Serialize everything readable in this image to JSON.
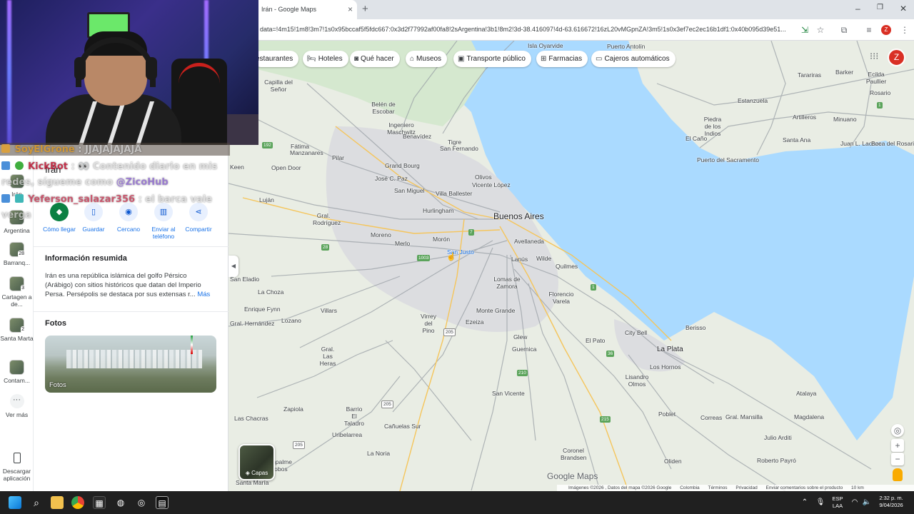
{
  "browser": {
    "tab_title": "Irán - Google Maps",
    "tab_close": "×",
    "new_tab": "+",
    "url": "data=!4m15!1m8!3m7!1s0x95bccaf5f5fdc667:0x3d2f77992af00fa8!2sArgentina!3b1!8m2!3d-38.416097!4d-63.616672!16zL20vMGpnZA!3m5!1s0x3ef7ec2ec16b1df1:0x40b095d39e51...",
    "minimize": "–",
    "restore": "❐",
    "close": "✕",
    "profile": "Z"
  },
  "chat": {
    "line1_user": "SoyElGrone",
    "line1_text": ": JJAJAJAJAJA",
    "line2_user": "KickBot",
    "line2_text": ": 👀 Contenido diario en mis",
    "line3_text": "redes, sígueme como",
    "line3_mention": "@ZicoHub",
    "line4_user": "Yeferson_salazar356",
    "line4_text": ": el barca vale",
    "line5_text": "verga"
  },
  "rail": {
    "item1_label": "Irán",
    "item2_label": "Argentina",
    "item3_label": "Barranq...",
    "item3_count": "28",
    "item4_label": "Cartagen a de...",
    "item4_count": "3",
    "item5_label": "Santa Marta",
    "item5_count": "2",
    "item6_label": "Contam...",
    "more_label": "Ver más",
    "download_label": "Descargar aplicación"
  },
  "panel": {
    "title": "Irán",
    "actions": {
      "directions": "Cómo llegar",
      "save": "Guardar",
      "nearby": "Cercano",
      "send": "Enviar al teléfono",
      "share": "Compartir"
    },
    "summary_title": "Información resumida",
    "summary_text": "Irán es una república islámica del golfo Pérsico (Arábigo) con sitios históricos que datan del Imperio Persa. Persépolis se destaca por sus extensas r...",
    "summary_more": "Más",
    "photos_title": "Fotos",
    "photos_label": "Fotos"
  },
  "chips": {
    "restaurants": "estaurantes",
    "hotels": "Hoteles",
    "things": "Qué hacer",
    "museums": "Museos",
    "transit": "Transporte público",
    "pharmacies": "Farmacias",
    "atms": "Cajeros automáticos"
  },
  "map": {
    "labels": {
      "buenos_aires": "Buenos Aires",
      "la_plata": "La Plata",
      "capilla": "Capilla del Señor",
      "belen": "Belén de Escobar",
      "ingeniero": "Ingeniero Maschwitz",
      "benavidez": "Benavídez",
      "tigre": "Tigre",
      "san_fernando": "San Fernando",
      "pilar": "Pilar",
      "grand_bourg": "Grand Bourg",
      "jose_c_paz": "José C. Paz",
      "san_miguel": "San Miguel",
      "olivos": "Olivos",
      "vicente_lopez": "Vicente López",
      "villa_ballester": "Villa Ballester",
      "hurlingham": "Hurlingham",
      "moreno": "Moreno",
      "merlo": "Merlo",
      "moron": "Morón",
      "san_justo": "San Justo",
      "avellaneda": "Avellaneda",
      "lanus": "Lanús",
      "wilde": "Wilde",
      "quilmes": "Quilmes",
      "lomas": "Lomas de Zamora",
      "florencio": "Florencio Varela",
      "monte_grande": "Monte Grande",
      "ezeiza": "Ezeiza",
      "virrey": "Virrey del Pino",
      "glew": "Glew",
      "guernica": "Guernica",
      "el_pato": "El Pato",
      "city_bell": "City Bell",
      "berisso": "Berisso",
      "los_hornos": "Los Hornos",
      "lisandro": "Lisandro Olmos",
      "san_vicente": "San Vicente",
      "correas": "Correas",
      "atalaya": "Atalaya",
      "poblet": "Poblet",
      "gral_mansilla": "Gral. Mansilla",
      "magdalena": "Magdalena",
      "julio_arditi": "Julio Arditi",
      "roberto_payro": "Roberto Payró",
      "oliden": "Oliden",
      "coronel": "Coronel Brandsen",
      "villars": "Villars",
      "las_heras": "Gral. Las Heras",
      "lozano": "Lozano",
      "gral_rodriguez": "Gral. Rodríguez",
      "lujan": "Luján",
      "open_door": "Open Door",
      "keen": "Keen",
      "san_eladio": "San Eladio",
      "la_choza": "La Choza",
      "enrique_fynn": "Enrique Fynn",
      "hernandez": "Gral. Hernández",
      "zapiola": "Zapiola",
      "barrio_el": "Barrio El Taladro",
      "canuelas": "Cañuelas Sur",
      "uribelarrea": "Uribelarrea",
      "las_chacras": "Las Chacras",
      "la_noria": "La Noria",
      "empalme": "Empalme Lobos",
      "santa_maria": "Santa María",
      "fatima": "Fátima",
      "manzanares": "Manzanares",
      "isla_oyarvide": "Isla Oyarvide",
      "puerto_antolin": "Puerto Antolín",
      "tarariras": "Tarariras",
      "barker": "Barker",
      "rosario": "Rosario",
      "ecilda": "Ecilda Paullier",
      "estanzuela": "Estanzuela",
      "piedra": "Piedra de los Indios",
      "artilleros": "Artilleros",
      "minuano": "Minuano",
      "el_cano": "El Caño",
      "santa_ana": "Santa Ana",
      "juan_lacaze": "Juan L. Lacaze",
      "boca_rosario": "Boca del Rosario",
      "puerto_sacramento": "Puerto del Sacramento"
    },
    "watermark": "Google Maps",
    "layers": "Capas",
    "footer_images": "Imágenes ©2026 , Datos del mapa ©2026 Google",
    "footer_country": "Colombia",
    "footer_terms": "Términos",
    "footer_privacy": "Privacidad",
    "footer_feedback": "Enviar comentarios sobre el producto",
    "footer_scale": "10 km"
  },
  "taskbar": {
    "lang": "ESP",
    "lang2": "LAA",
    "time": "2:32 p. m.",
    "date": "9/04/2026"
  },
  "colors": {
    "accent": "#1a73e8",
    "directions": "#0b8043",
    "water": "#aadaff",
    "land": "#e9ede4"
  }
}
